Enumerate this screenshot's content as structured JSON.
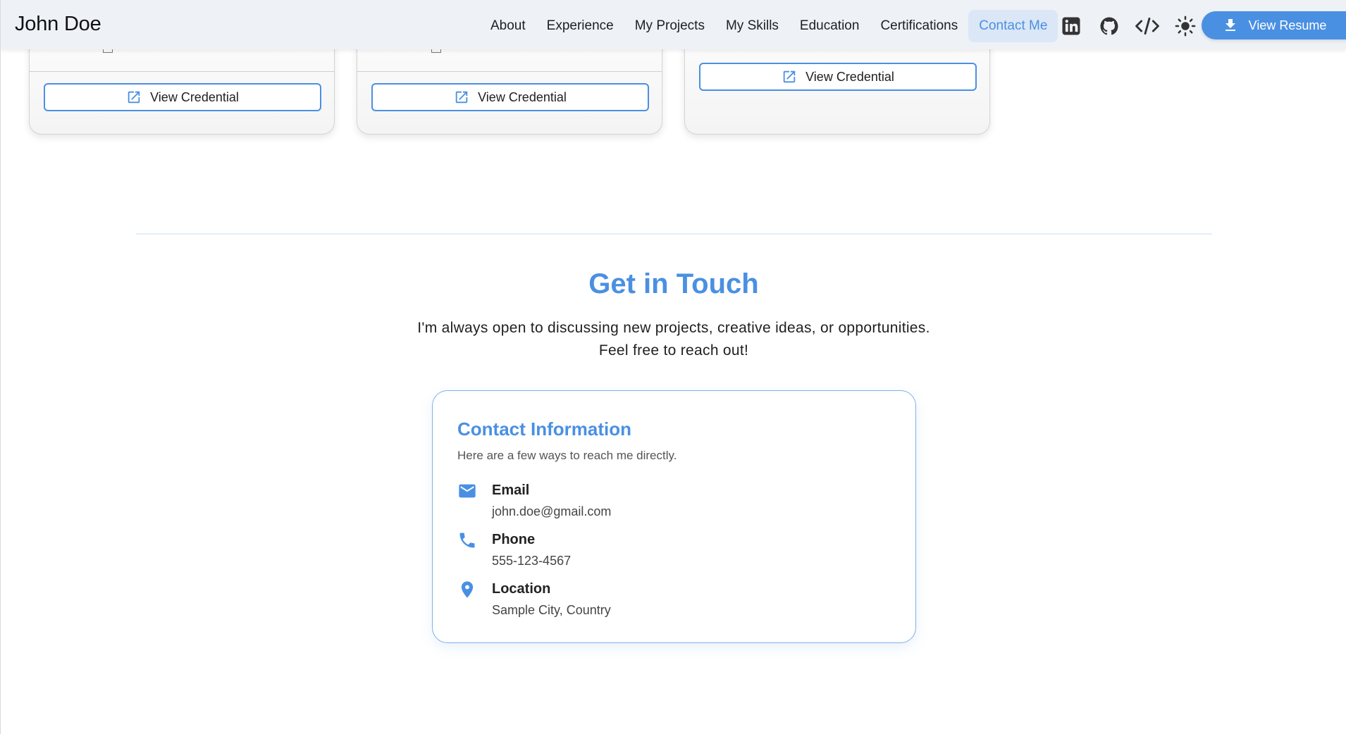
{
  "header": {
    "brand": "John Doe",
    "nav": [
      "About",
      "Experience",
      "My Projects",
      "My Skills",
      "Education",
      "Certifications",
      "Contact Me"
    ],
    "active_nav": "Contact Me",
    "icons": [
      "linkedin-icon",
      "github-icon",
      "code-icon",
      "sun-icon"
    ],
    "resume_label": "View Resume"
  },
  "certifications": {
    "credential_label": "View Credential"
  },
  "contact": {
    "title": "Get in Touch",
    "subtitle_line1": "I'm always open to discussing new projects, creative ideas, or opportunities.",
    "subtitle_line2": "Feel free to reach out!",
    "card_title": "Contact Information",
    "card_desc": "Here are a few ways to reach me directly.",
    "items": [
      {
        "icon": "mail-icon",
        "label": "Email",
        "value": "john.doe@gmail.com"
      },
      {
        "icon": "phone-icon",
        "label": "Phone",
        "value": "555-123-4567"
      },
      {
        "icon": "location-pin-icon",
        "label": "Location",
        "value": "Sample City, Country"
      }
    ]
  },
  "colors": {
    "accent": "#4a90e2",
    "navbar_bg": "#eef2f7",
    "active_nav_bg": "#dbe7f6"
  }
}
